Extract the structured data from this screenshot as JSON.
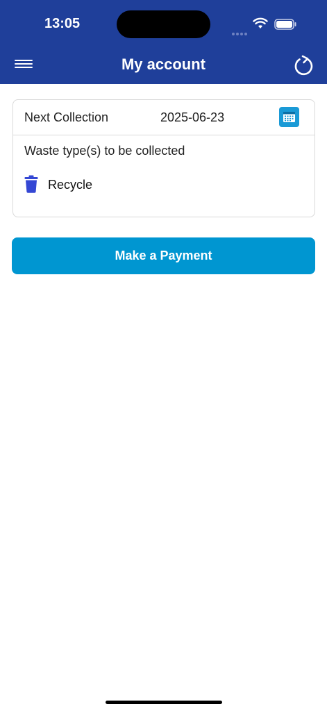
{
  "status_bar": {
    "time": "13:05"
  },
  "header": {
    "title": "My account",
    "menu_icon": "hamburger-menu-icon",
    "refresh_icon": "refresh-icon",
    "background_color": "#1f3f9a"
  },
  "collection_card": {
    "next_collection_label": "Next Collection",
    "next_collection_date": "2025-06-23",
    "calendar_icon": "calendar-icon",
    "waste_heading": "Waste type(s) to be collected",
    "waste_types": [
      {
        "label": "Recycle",
        "icon": "trash-icon",
        "color": "#3447d4"
      }
    ]
  },
  "actions": {
    "payment_label": "Make a Payment",
    "payment_color": "#0096d1"
  }
}
